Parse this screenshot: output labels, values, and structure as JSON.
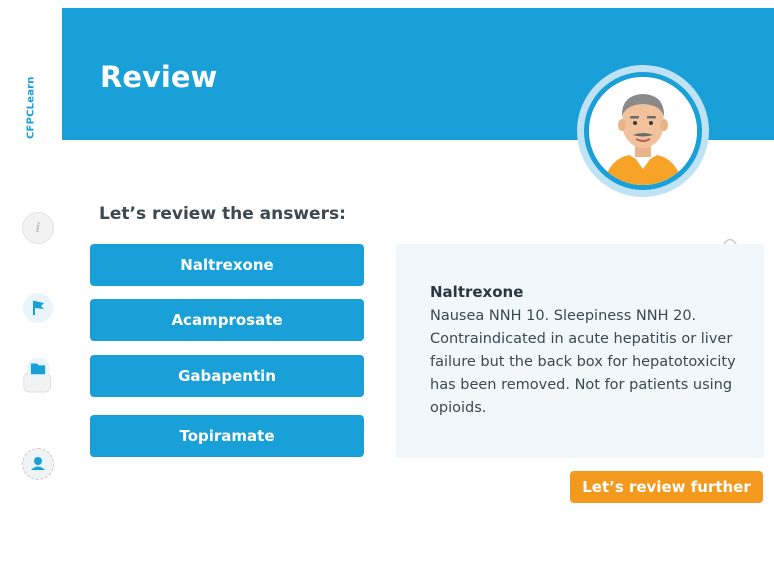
{
  "brand": {
    "name": "CFPCLearn"
  },
  "header": {
    "title": "Review"
  },
  "rail": {
    "icons": [
      "info-icon",
      "flag-icon",
      "glossary-icon",
      "profile-icon"
    ]
  },
  "main": {
    "prompt": "Let’s review the answers:",
    "answers": [
      {
        "label": "Naltrexone"
      },
      {
        "label": "Acamprosate"
      },
      {
        "label": "Gabapentin"
      },
      {
        "label": "Topiramate"
      }
    ],
    "detail": {
      "title": "Naltrexone",
      "body": "Nausea NNH 10. Sleepiness NNH 20. Contraindicated in acute hepatitis or liver failure but the back box for hepatotoxicity has been removed. Not for patients using opioids."
    },
    "next_button": "Let’s review further"
  },
  "colors": {
    "accent": "#1aa0d8",
    "cta": "#f39a1e",
    "panel": "#f2f7fb",
    "text": "#3d4850"
  }
}
